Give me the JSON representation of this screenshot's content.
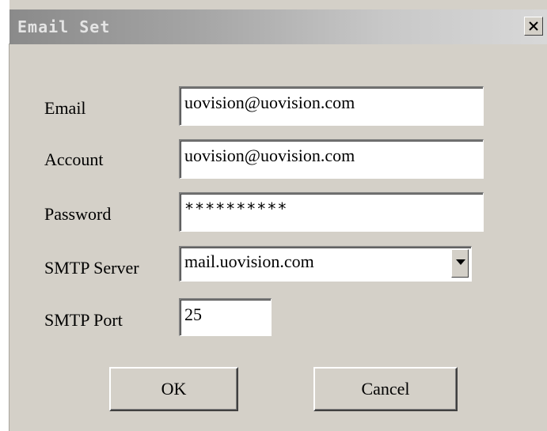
{
  "window": {
    "title": "Email Set",
    "close_label": "×"
  },
  "form": {
    "email": {
      "label": "Email",
      "value": "uovision@uovision.com"
    },
    "account": {
      "label": "Account",
      "value": "uovision@uovision.com"
    },
    "password": {
      "label": "Password",
      "value": "**********"
    },
    "smtp_server": {
      "label": "SMTP Server",
      "value": "mail.uovision.com"
    },
    "smtp_port": {
      "label": "SMTP Port",
      "value": "25"
    }
  },
  "buttons": {
    "ok_label": "OK",
    "cancel_label": "Cancel"
  },
  "icons": {
    "close": "close-icon",
    "dropdown": "chevron-down-icon"
  }
}
